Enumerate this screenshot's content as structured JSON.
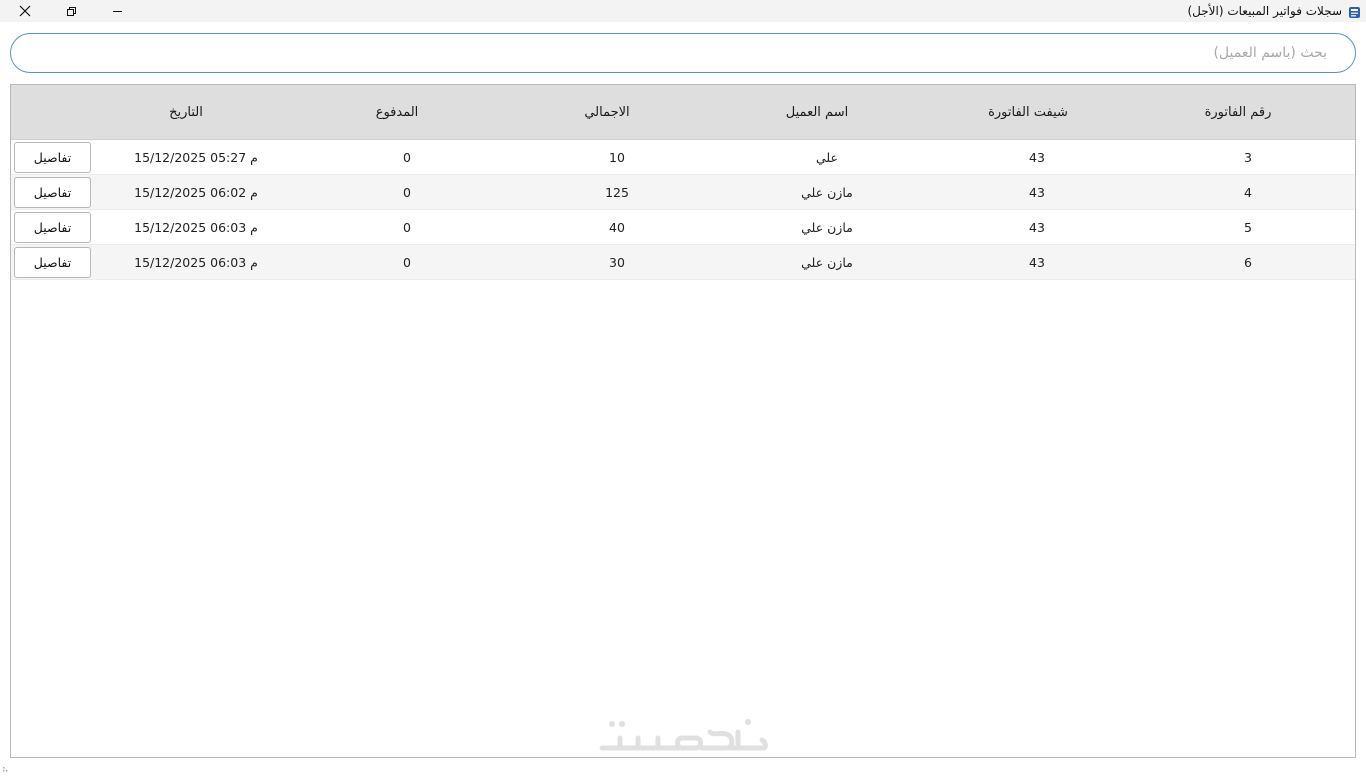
{
  "window": {
    "title": "سجلات فواتير المبيعات (الأجل)",
    "close_icon": "close-icon",
    "restore_icon": "restore-icon",
    "minimize_icon": "minimize-icon"
  },
  "search": {
    "value": "",
    "placeholder": "بحث (باسم العميل)"
  },
  "table": {
    "columns": [
      "رقم الفاتورة",
      "شيفت الفاتورة",
      "اسم العميل",
      "الاجمالي",
      "المدفوع",
      "التاريخ"
    ],
    "rows": [
      {
        "invoice_no": "3",
        "shift": "43",
        "customer": "علي",
        "total": "10",
        "paid": "0",
        "date": "15/12/2025 05:27 م",
        "action": "تفاصيل"
      },
      {
        "invoice_no": "4",
        "shift": "43",
        "customer": "مازن علي",
        "total": "125",
        "paid": "0",
        "date": "15/12/2025 06:02 م",
        "action": "تفاصيل"
      },
      {
        "invoice_no": "5",
        "shift": "43",
        "customer": "مازن علي",
        "total": "40",
        "paid": "0",
        "date": "15/12/2025 06:03 م",
        "action": "تفاصيل"
      },
      {
        "invoice_no": "6",
        "shift": "43",
        "customer": "مازن علي",
        "total": "30",
        "paid": "0",
        "date": "15/12/2025 06:03 م",
        "action": "تفاصيل"
      }
    ]
  },
  "colors": {
    "accent": "#5b8fd1",
    "header_bg": "#dedede",
    "alt_row_bg": "#f5f5f5"
  }
}
